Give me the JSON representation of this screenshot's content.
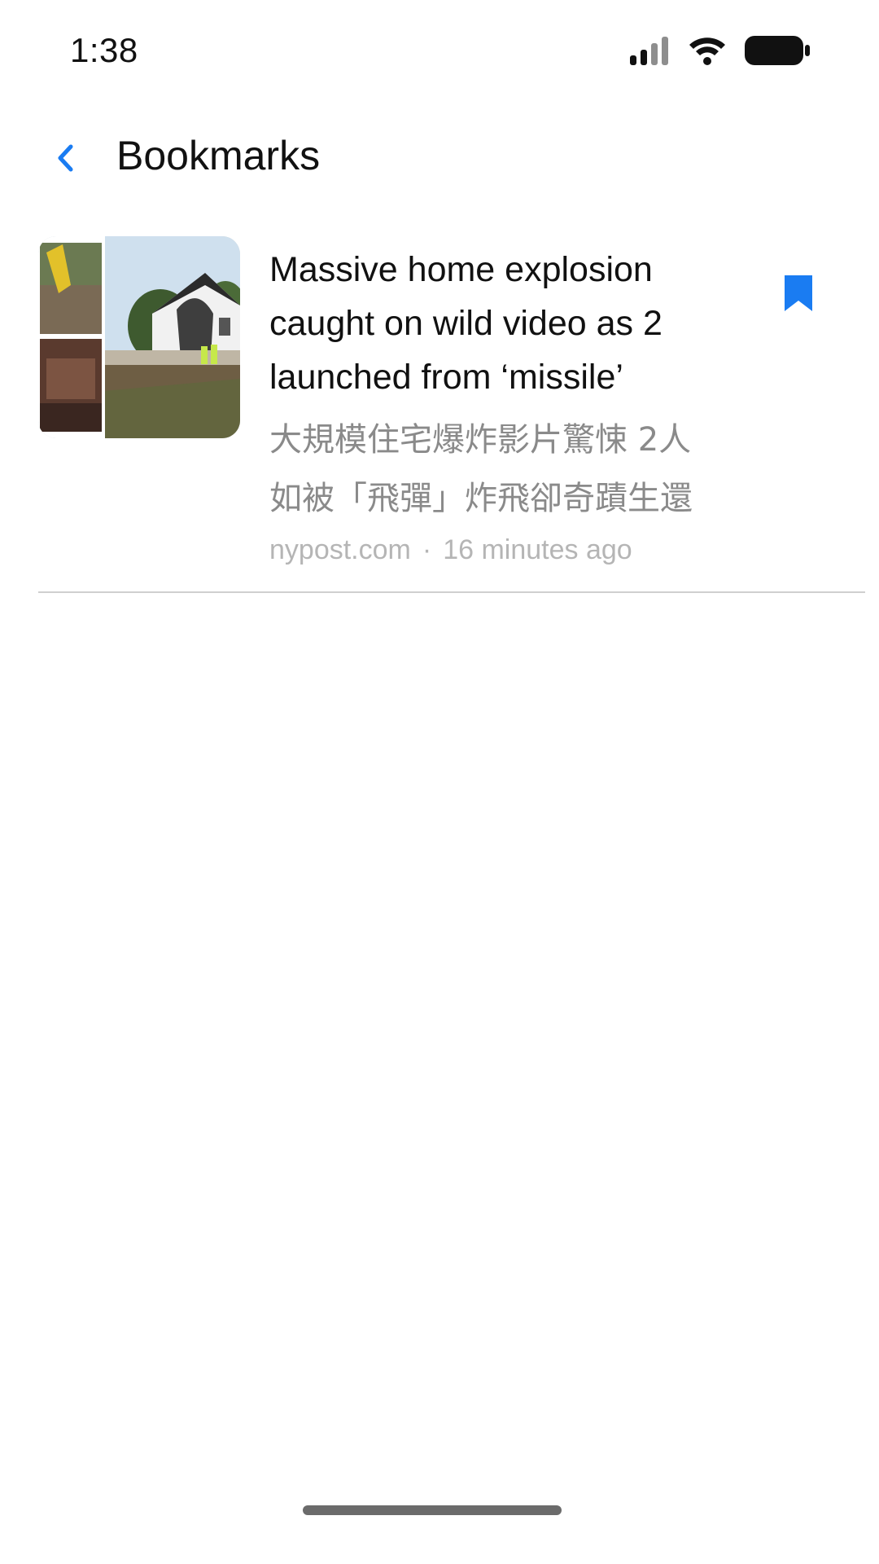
{
  "status_bar": {
    "time": "1:38",
    "icons": [
      "signal-icon",
      "wifi-icon",
      "battery-icon"
    ]
  },
  "header": {
    "back_icon": "chevron-left-icon",
    "title": "Bookmarks"
  },
  "colors": {
    "accent": "#1a7cf2",
    "text_primary": "#111111",
    "text_secondary": "#8a8a8a",
    "text_meta": "#b5b5b5",
    "divider": "#cfcfcf"
  },
  "bookmarks": [
    {
      "title": "Massive home explosion caught on wild video as 2 launched from ‘missile’",
      "translation_line1": "大規模住宅爆炸影片驚悚 2人",
      "translation_line2": "如被「飛彈」炸飛卻奇蹟生還",
      "source": "nypost.com",
      "separator": "·",
      "time_ago": "16 minutes ago",
      "bookmark_icon": "bookmark-filled-icon",
      "thumbnail": "explosion-photo-collage"
    }
  ]
}
